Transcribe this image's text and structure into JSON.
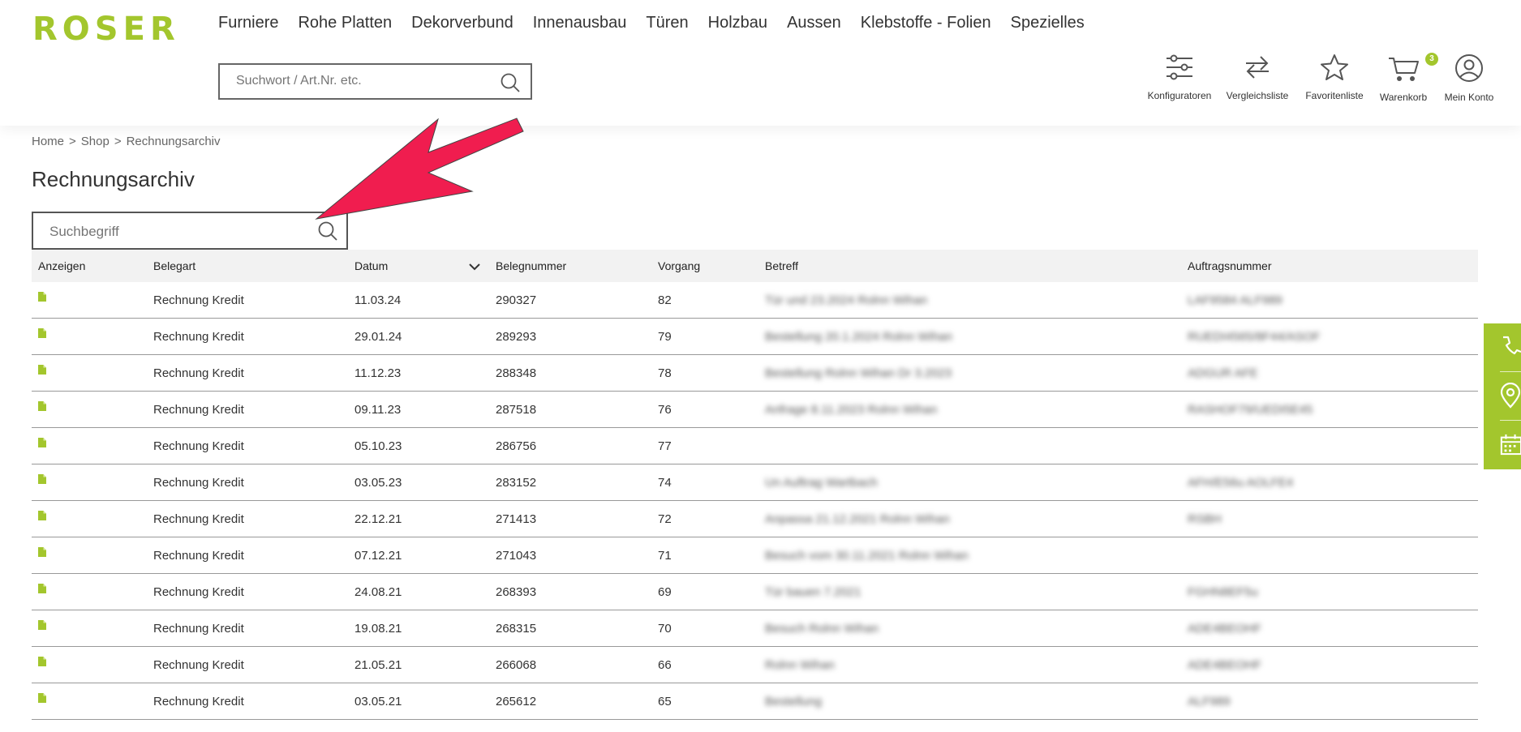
{
  "brand": {
    "logo_text": "ROSER",
    "accent": "#a3c62d"
  },
  "nav": {
    "items": [
      "Furniere",
      "Rohe Platten",
      "Dekorverbund",
      "Innenausbau",
      "Türen",
      "Holzbau",
      "Aussen",
      "Klebstoffe - Folien",
      "Spezielles"
    ]
  },
  "search": {
    "placeholder": "Suchwort / Art.Nr. etc."
  },
  "tools": {
    "konfiguratoren": "Konfiguratoren",
    "vergleich": "Vergleichsliste",
    "favoriten": "Favoritenliste",
    "warenkorb": "Warenkorb",
    "warenkorb_count": "3",
    "konto": "Mein Konto"
  },
  "breadcrumb": {
    "home": "Home",
    "shop": "Shop",
    "current": "Rechnungsarchiv",
    "separator": ">"
  },
  "page": {
    "title": "Rechnungsarchiv",
    "search_placeholder": "Suchbegriff"
  },
  "table": {
    "headers": {
      "anzeigen": "Anzeigen",
      "belegart": "Belegart",
      "datum": "Datum",
      "belegnummer": "Belegnummer",
      "vorgang": "Vorgang",
      "betreff": "Betreff",
      "auftragsnummer": "Auftragsnummer"
    },
    "rows": [
      {
        "belegart": "Rechnung Kredit",
        "datum": "11.03.24",
        "belegnummer": "290327",
        "vorgang": "82",
        "betreff": "Tür und 23.2024 Rolnn Wihan",
        "auftragsnummer": "LAF9584 ALF989"
      },
      {
        "belegart": "Rechnung Kredit",
        "datum": "29.01.24",
        "belegnummer": "289293",
        "vorgang": "79",
        "betreff": "Bestellung 20.1.2024 Rolnn Wihan",
        "auftragsnummer": "RUEDI4565/8F44/ASOF"
      },
      {
        "belegart": "Rechnung Kredit",
        "datum": "11.12.23",
        "belegnummer": "288348",
        "vorgang": "78",
        "betreff": "Bestellung Rolnn Wihan Dr 3.2023",
        "auftragsnummer": "ADGUR AFE"
      },
      {
        "belegart": "Rechnung Kredit",
        "datum": "09.11.23",
        "belegnummer": "287518",
        "vorgang": "76",
        "betreff": "Anfrage 8.11.2023 Rolnn Wihan",
        "auftragsnummer": "RASHOF79/UEDI5E45"
      },
      {
        "belegart": "Rechnung Kredit",
        "datum": "05.10.23",
        "belegnummer": "286756",
        "vorgang": "77",
        "betreff": "",
        "auftragsnummer": ""
      },
      {
        "belegart": "Rechnung Kredit",
        "datum": "03.05.23",
        "belegnummer": "283152",
        "vorgang": "74",
        "betreff": "Un Auftrag Wartbach",
        "auftragsnummer": "AFH/E56u AOLFE4"
      },
      {
        "belegart": "Rechnung Kredit",
        "datum": "22.12.21",
        "belegnummer": "271413",
        "vorgang": "72",
        "betreff": "Anpassa 21.12.2021 Rolnn Wihan",
        "auftragsnummer": "RSBH"
      },
      {
        "belegart": "Rechnung Kredit",
        "datum": "07.12.21",
        "belegnummer": "271043",
        "vorgang": "71",
        "betreff": "Besuch vom 30.11.2021 Rolnn Wihan",
        "auftragsnummer": ""
      },
      {
        "belegart": "Rechnung Kredit",
        "datum": "24.08.21",
        "belegnummer": "268393",
        "vorgang": "69",
        "betreff": "Tür bauen 7.2021",
        "auftragsnummer": "FGHN8EF5u"
      },
      {
        "belegart": "Rechnung Kredit",
        "datum": "19.08.21",
        "belegnummer": "268315",
        "vorgang": "70",
        "betreff": "Besuch Rolnn Wihan",
        "auftragsnummer": "ADE4BEOHF"
      },
      {
        "belegart": "Rechnung Kredit",
        "datum": "21.05.21",
        "belegnummer": "266068",
        "vorgang": "66",
        "betreff": "Rolnn Wihan",
        "auftragsnummer": "ADE4BEOHF"
      },
      {
        "belegart": "Rechnung Kredit",
        "datum": "03.05.21",
        "belegnummer": "265612",
        "vorgang": "65",
        "betreff": "Bestellung",
        "auftragsnummer": "ALF989"
      }
    ]
  }
}
